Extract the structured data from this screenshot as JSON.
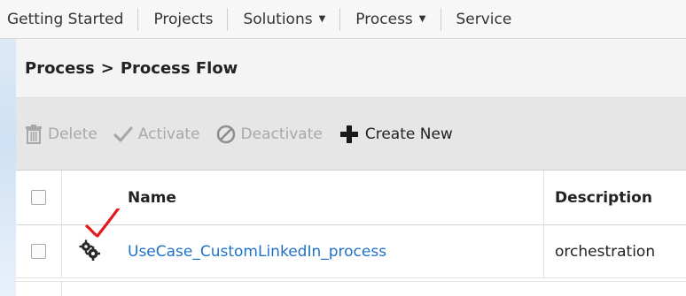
{
  "nav": {
    "items": [
      {
        "label": "Getting Started",
        "dropdown": false
      },
      {
        "label": "Projects",
        "dropdown": false
      },
      {
        "label": "Solutions",
        "dropdown": true
      },
      {
        "label": "Process",
        "dropdown": true
      },
      {
        "label": "Service",
        "dropdown": false
      }
    ]
  },
  "breadcrumb": {
    "parent": "Process",
    "separator": ">",
    "current": "Process Flow"
  },
  "toolbar": {
    "delete_label": "Delete",
    "activate_label": "Activate",
    "deactivate_label": "Deactivate",
    "create_label": "Create New"
  },
  "table": {
    "columns": {
      "name": "Name",
      "description": "Description"
    },
    "rows": [
      {
        "name": "UseCase_CustomLinkedIn_process",
        "description": "orchestration"
      }
    ]
  },
  "colors": {
    "link": "#1f72c7",
    "annotation": "#e0191b",
    "disabled": "#a8a8a8"
  }
}
